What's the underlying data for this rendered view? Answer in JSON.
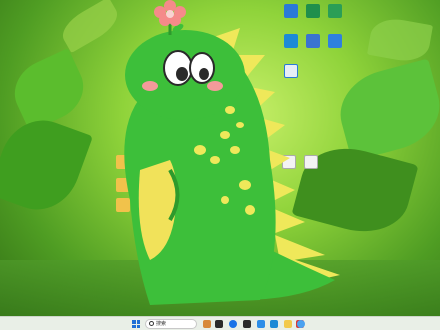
{
  "desktop": {
    "icons": [
      {
        "name": "app-icon-1",
        "label": "",
        "color": "#2a7ad8"
      },
      {
        "name": "app-icon-2",
        "label": "",
        "color": "#1f8f4c"
      },
      {
        "name": "app-icon-3",
        "label": "",
        "color": "#2b9e56"
      },
      {
        "name": "app-icon-4",
        "label": "",
        "color": "#1c8ad6"
      },
      {
        "name": "app-icon-5",
        "label": "",
        "color": "#3a74d0"
      },
      {
        "name": "app-icon-6",
        "label": "",
        "color": "#2f80de"
      },
      {
        "name": "app-icon-7",
        "label": "",
        "color": "#e7eef7"
      },
      {
        "name": "folder-icon-1",
        "label": "",
        "color": "#f1c24b"
      },
      {
        "name": "folder-icon-2",
        "label": "",
        "color": "#f1c24b"
      },
      {
        "name": "folder-icon-3",
        "label": "",
        "color": "#f1c24b"
      },
      {
        "name": "doc-icon-1",
        "label": "",
        "color": "#f3f3f3"
      },
      {
        "name": "doc-icon-2",
        "label": "",
        "color": "#f3f3f3"
      }
    ]
  },
  "taskbar": {
    "search_label": "搜索",
    "apps": [
      {
        "name": "taskbar-app-1",
        "color": "#d8893a"
      },
      {
        "name": "taskbar-app-2",
        "color": "#2a2a2a"
      },
      {
        "name": "taskbar-app-3",
        "color": "#1a73e8"
      },
      {
        "name": "taskbar-app-4",
        "color": "#2b2b2b"
      },
      {
        "name": "taskbar-app-5",
        "color": "#2d8ee8"
      },
      {
        "name": "taskbar-app-6",
        "color": "#1c8ad6"
      },
      {
        "name": "taskbar-app-7",
        "color": "#f2c94c"
      },
      {
        "name": "taskbar-app-8",
        "color": "#d73a3a"
      },
      {
        "name": "taskbar-app-9",
        "color": "#4aa1f0"
      }
    ],
    "tray_text": ""
  },
  "colors": {
    "accent": "#1f6fd6",
    "dino_body": "#3dbf3a",
    "dino_belly": "#f1e25a",
    "dino_spikes": "#efe85a",
    "flower": "#f58a8a"
  }
}
